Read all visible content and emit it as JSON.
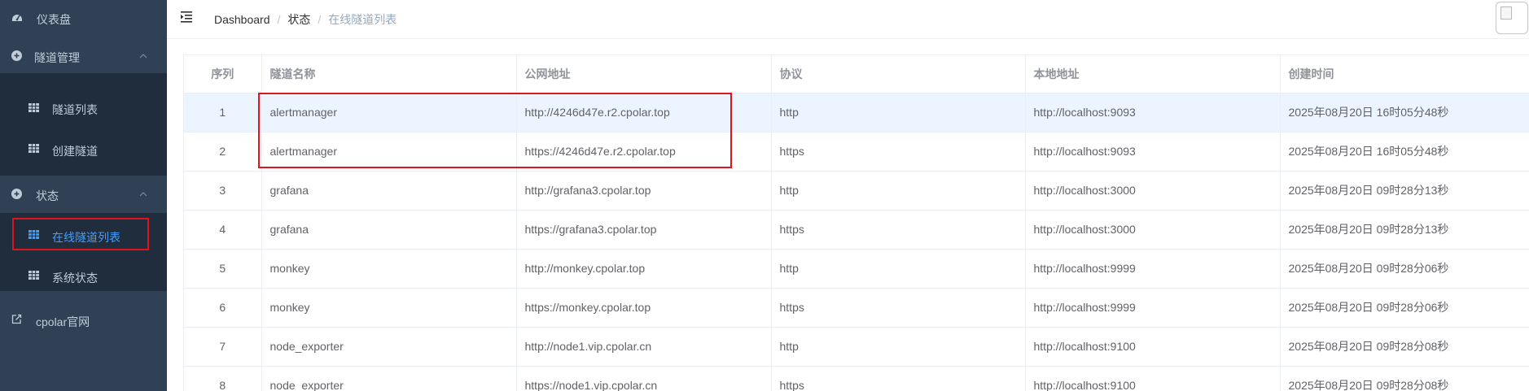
{
  "sidebar": {
    "items": [
      {
        "label": "仪表盘",
        "icon": "dashboard-icon"
      },
      {
        "label": "隧道管理",
        "icon": "plus-circle-icon"
      },
      {
        "label": "隧道列表",
        "icon": "table-icon"
      },
      {
        "label": "创建隧道",
        "icon": "table-icon"
      },
      {
        "label": "状态",
        "icon": "plus-circle-icon"
      },
      {
        "label": "在线隧道列表",
        "icon": "table-icon"
      },
      {
        "label": "系统状态",
        "icon": "table-icon"
      },
      {
        "label": "cpolar官网",
        "icon": "external-link-icon"
      }
    ]
  },
  "header": {
    "breadcrumb": [
      "Dashboard",
      "状态",
      "在线隧道列表"
    ]
  },
  "table": {
    "columns": [
      "序列",
      "隧道名称",
      "公网地址",
      "协议",
      "本地地址",
      "创建时间"
    ],
    "rows": [
      [
        "1",
        "alertmanager",
        "http://4246d47e.r2.cpolar.top",
        "http",
        "http://localhost:9093",
        "2025年08月20日 16时05分48秒"
      ],
      [
        "2",
        "alertmanager",
        "https://4246d47e.r2.cpolar.top",
        "https",
        "http://localhost:9093",
        "2025年08月20日 16时05分48秒"
      ],
      [
        "3",
        "grafana",
        "http://grafana3.cpolar.top",
        "http",
        "http://localhost:3000",
        "2025年08月20日 09时28分13秒"
      ],
      [
        "4",
        "grafana",
        "https://grafana3.cpolar.top",
        "https",
        "http://localhost:3000",
        "2025年08月20日 09时28分13秒"
      ],
      [
        "5",
        "monkey",
        "http://monkey.cpolar.top",
        "http",
        "http://localhost:9999",
        "2025年08月20日 09时28分06秒"
      ],
      [
        "6",
        "monkey",
        "https://monkey.cpolar.top",
        "https",
        "http://localhost:9999",
        "2025年08月20日 09时28分06秒"
      ],
      [
        "7",
        "node_exporter",
        "http://node1.vip.cpolar.cn",
        "http",
        "http://localhost:9100",
        "2025年08月20日 09时28分08秒"
      ],
      [
        "8",
        "node_exporter",
        "https://node1.vip.cpolar.cn",
        "https",
        "http://localhost:9100",
        "2025年08月20日 09时28分08秒"
      ]
    ]
  },
  "colors": {
    "sidebar_bg": "#304156",
    "submenu_bg": "#1f2d3d",
    "active": "#409eff",
    "highlight_row": "#ecf5ff",
    "annotation_red": "#e0141e"
  }
}
